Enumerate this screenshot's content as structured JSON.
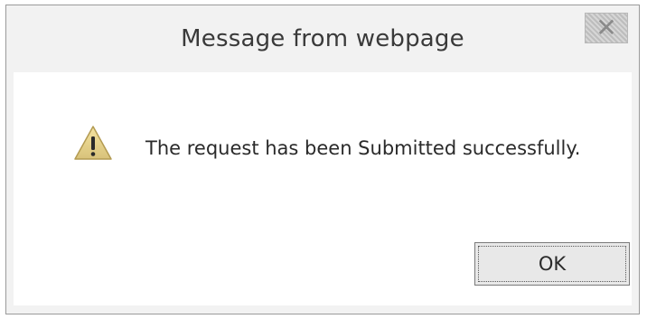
{
  "dialog": {
    "title": "Message from webpage",
    "close_glyph": "✕",
    "message": "The request has been Submitted successfully.",
    "icon": "warning-icon",
    "ok_label": "OK"
  }
}
